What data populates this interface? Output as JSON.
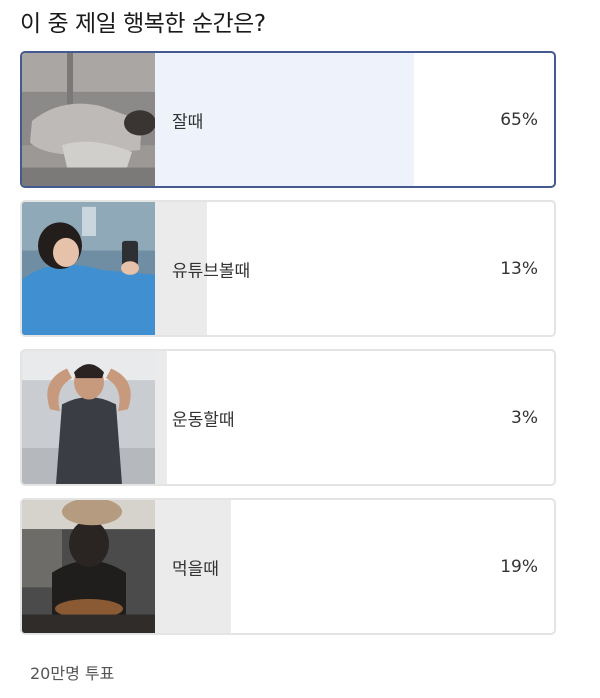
{
  "poll": {
    "question": "이 중 제일 행복한 순간은?",
    "options": [
      {
        "label": "잘때",
        "percent_text": "65%",
        "percent": 65,
        "selected": true,
        "thumbnail": "person-sleeping-on-floor"
      },
      {
        "label": "유튜브볼때",
        "percent_text": "13%",
        "percent": 13,
        "selected": false,
        "thumbnail": "person-lying-watching-phone"
      },
      {
        "label": "운동할때",
        "percent_text": "3%",
        "percent": 3,
        "selected": false,
        "thumbnail": "man-flexing-at-gym"
      },
      {
        "label": "먹을때",
        "percent_text": "19%",
        "percent": 19,
        "selected": false,
        "thumbnail": "man-eating-noodles"
      }
    ],
    "total_votes": "20만명 투표"
  },
  "colors": {
    "selected_border": "#44598f",
    "selected_fill": "#eef3fb",
    "default_fill": "#ebebeb",
    "default_border": "#e4e4e4"
  }
}
